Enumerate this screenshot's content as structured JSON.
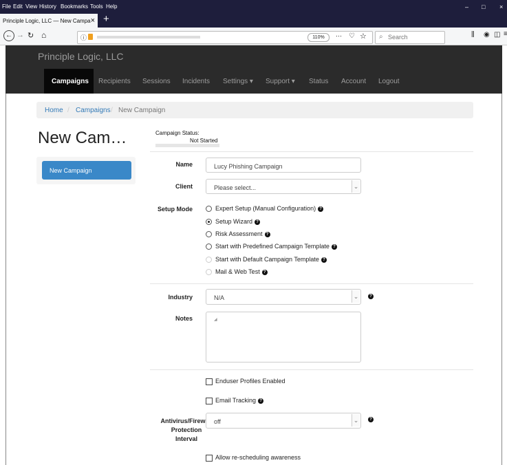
{
  "browser": {
    "menu": [
      "File",
      "Edit",
      "View",
      "History",
      "Bookmarks",
      "Tools",
      "Help"
    ],
    "tab_title": "Principle Logic, LLC — New Campa",
    "tab_close": "×",
    "new_tab": "+",
    "zoom": "110%",
    "more": "···",
    "search_placeholder": "Search",
    "window_controls": [
      "–",
      "□",
      "×"
    ]
  },
  "app": {
    "brand": "Principle Logic, LLC",
    "nav": [
      "Campaigns",
      "Recipients",
      "Sessions",
      "Incidents",
      "Settings ▾",
      "Support ▾",
      "Status",
      "Account",
      "Logout"
    ],
    "active_nav": "Campaigns"
  },
  "breadcrumb": {
    "home": "Home",
    "sep": "/",
    "campaigns": "Campaigns",
    "current": "New Campaign"
  },
  "page": {
    "title": "New Cam…",
    "status_label": "Campaign Status:",
    "status_value": "Not Started",
    "side_button": "New Campaign"
  },
  "form": {
    "name_label": "Name",
    "name_value": "Lucy Phishing Campaign",
    "client_label": "Client",
    "client_value": "Please select...",
    "setup_label": "Setup Mode",
    "setup_options": [
      {
        "label": "Expert Setup (Manual Configuration)",
        "checked": false,
        "help": true
      },
      {
        "label": "Setup Wizard",
        "checked": true,
        "help": true
      },
      {
        "label": "Risk Assessment",
        "checked": false,
        "help": true
      },
      {
        "label": "Start with Predefined Campaign Template",
        "checked": false,
        "help": true
      },
      {
        "label": "Start with Default Campaign Template",
        "checked": false,
        "help": true
      },
      {
        "label": "Mail & Web Test",
        "checked": false,
        "help": true
      }
    ],
    "industry_label": "Industry",
    "industry_value": "N/A",
    "notes_label": "Notes",
    "enduser_profiles": "Enduser Profiles Enabled",
    "email_tracking": "Email Tracking",
    "av_label_1": "Antivirus/Firewall",
    "av_label_2": "Protection",
    "av_label_3": "Interval",
    "av_value": "off",
    "reschedule": "Allow re-scheduling awareness"
  },
  "icons": {
    "help": "?",
    "caret": "⌄"
  }
}
